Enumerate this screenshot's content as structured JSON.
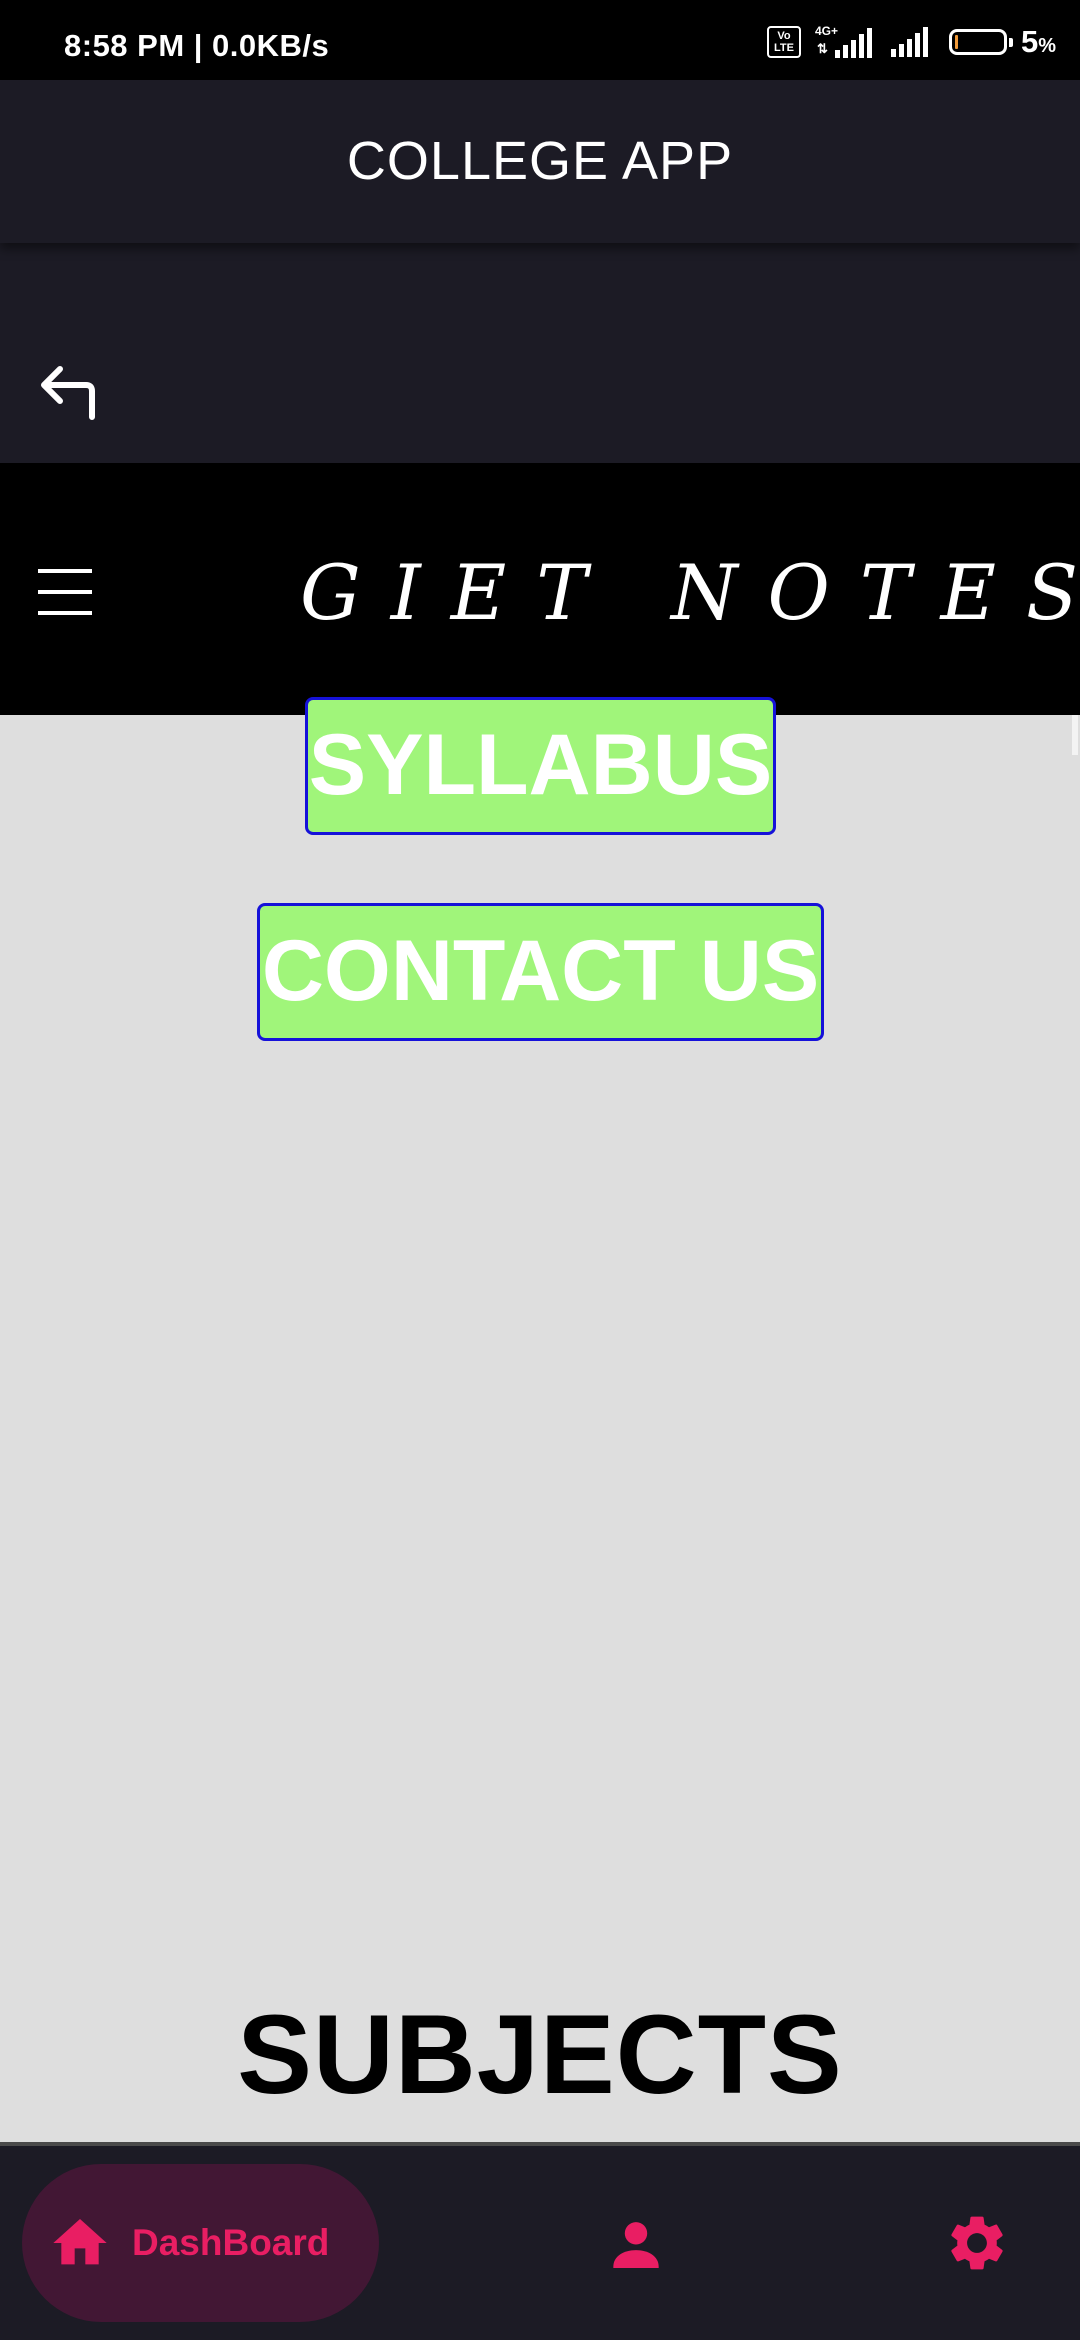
{
  "status_bar": {
    "time": "8:58 PM | 0.0KB/s",
    "volte_line1": "Vo",
    "volte_line2": "LTE",
    "network": "4G+",
    "battery_percent": "5",
    "battery_unit": "%",
    "battery_level": 0.05
  },
  "app_bar": {
    "title": "COLLEGE APP",
    "back_icon": "back-arrow-icon"
  },
  "site_header": {
    "title": "GIET NOTES",
    "menu_icon": "hamburger-menu-icon"
  },
  "content": {
    "buttons": [
      {
        "label": "SYLLABUS"
      },
      {
        "label": "CONTACT US"
      }
    ],
    "heading": "SUBJECTS"
  },
  "bottom_nav": {
    "items": [
      {
        "label": "DashBoard",
        "icon": "home-icon",
        "active": true
      },
      {
        "label": "",
        "icon": "person-icon",
        "active": false
      },
      {
        "label": "",
        "icon": "gear-icon",
        "active": false
      }
    ]
  },
  "colors": {
    "app_bar_bg": "#1c1b25",
    "accent": "#e91e63",
    "button_bg": "#a0f57a",
    "button_border": "#1612d9",
    "content_bg": "#dedede"
  }
}
